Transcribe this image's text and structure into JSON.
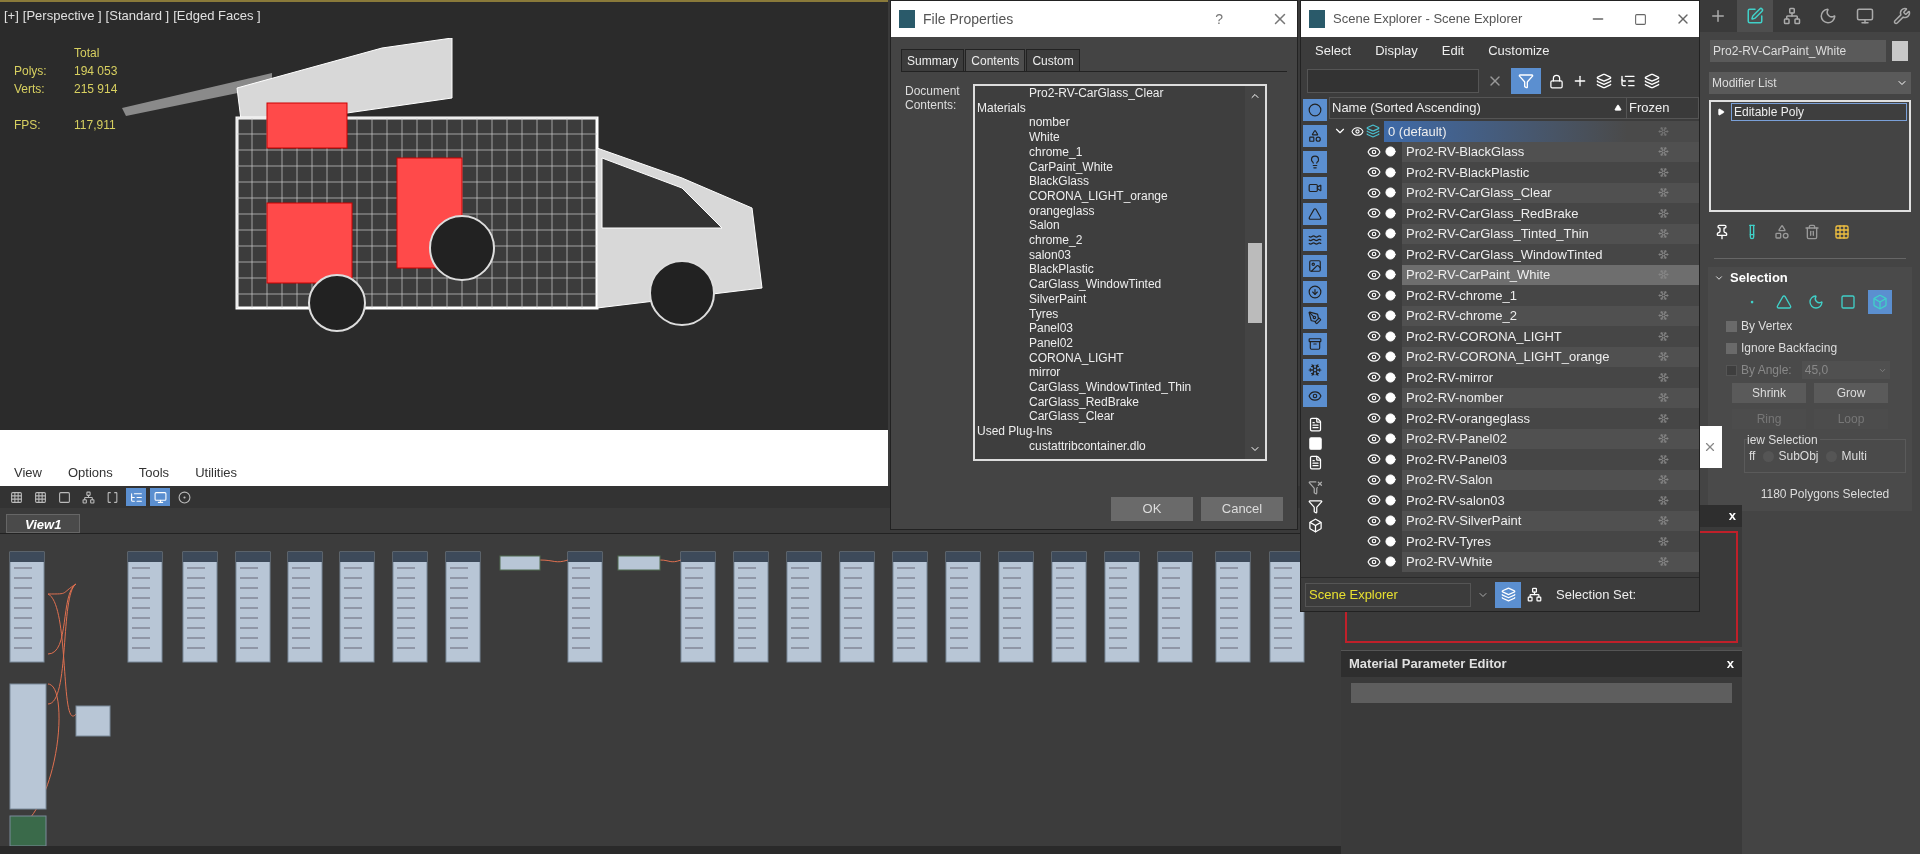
{
  "viewport": {
    "labels": [
      "[+]",
      "[Perspective ]",
      "[Standard ]",
      "[Edged Faces ]"
    ],
    "stats": {
      "header": "Total",
      "rows": [
        {
          "label": "Polys:",
          "value": "194 053"
        },
        {
          "label": "Verts:",
          "value": "215 914"
        }
      ],
      "fps": {
        "label": "FPS:",
        "value": "117,911"
      }
    }
  },
  "material_editor": {
    "menu": [
      "View",
      "Options",
      "Tools",
      "Utilities"
    ],
    "toolbar": [
      {
        "on": false
      },
      {
        "on": false
      },
      {
        "on": false
      },
      {
        "on": false
      },
      {
        "on": false
      },
      {
        "on": true
      },
      {
        "on": true
      },
      {
        "on": false
      }
    ],
    "tabs": [
      {
        "label": "View1",
        "selected": true
      }
    ],
    "navigator": {
      "close": "x"
    },
    "parameter_editor": {
      "title": "Material Parameter Editor",
      "close": "x"
    }
  },
  "file_properties": {
    "title": "File Properties",
    "help": "?",
    "tabs": [
      {
        "label": "Summary",
        "selected": false
      },
      {
        "label": "Contents",
        "selected": true
      },
      {
        "label": "Custom",
        "selected": false
      }
    ],
    "field_label": "Document Contents:",
    "contents": [
      {
        "items": [
          "Pro2-RV-CarGlass_Clear"
        ]
      },
      {
        "label": "Materials",
        "items": [
          "nomber",
          "White",
          "chrome_1",
          "CarPaint_White",
          "BlackGlass",
          "CORONA_LIGHT_orange",
          "orangeglass",
          "Salon",
          "chrome_2",
          "salon03",
          "BlackPlastic",
          "CarGlass_WindowTinted",
          "SilverPaint",
          "Tyres",
          "Panel03",
          "Panel02",
          "CORONA_LIGHT",
          "mirror",
          "CarGlass_WindowTinted_Thin",
          "CarGlass_RedBrake",
          "CarGlass_Clear"
        ]
      },
      {
        "label": "Used Plug-Ins",
        "items": [
          "custattribcontainer.dlo"
        ]
      }
    ],
    "buttons": [
      "OK",
      "Cancel"
    ]
  },
  "scene_explorer": {
    "title": "Scene Explorer - Scene Explorer",
    "menu": [
      "Select",
      "Display",
      "Edit",
      "Customize"
    ],
    "filter_active": true,
    "filters": [
      {
        "on": true
      },
      {
        "on": true
      },
      {
        "on": true
      },
      {
        "on": true
      },
      {
        "on": true
      },
      {
        "on": true
      },
      {
        "on": true
      },
      {
        "on": true
      },
      {
        "on": true
      },
      {
        "on": true
      },
      {
        "on": true
      },
      {
        "on": true
      }
    ],
    "columns": [
      "Name (Sorted Ascending)",
      "Frozen"
    ],
    "layer": {
      "name": "0 (default)",
      "expanded": true,
      "selected": true,
      "children": [
        {
          "name": "Pro2-RV-BlackGlass",
          "selected": false
        },
        {
          "name": "Pro2-RV-BlackPlastic",
          "selected": false
        },
        {
          "name": "Pro2-RV-CarGlass_Clear",
          "selected": false
        },
        {
          "name": "Pro2-RV-CarGlass_RedBrake",
          "selected": false
        },
        {
          "name": "Pro2-RV-CarGlass_Tinted_Thin",
          "selected": false
        },
        {
          "name": "Pro2-RV-CarGlass_WindowTinted",
          "selected": false
        },
        {
          "name": "Pro2-RV-CarPaint_White",
          "selected": true
        },
        {
          "name": "Pro2-RV-chrome_1",
          "selected": false
        },
        {
          "name": "Pro2-RV-chrome_2",
          "selected": false
        },
        {
          "name": "Pro2-RV-CORONA_LIGHT",
          "selected": false
        },
        {
          "name": "Pro2-RV-CORONA_LIGHT_orange",
          "selected": false
        },
        {
          "name": "Pro2-RV-mirror",
          "selected": false
        },
        {
          "name": "Pro2-RV-nomber",
          "selected": false
        },
        {
          "name": "Pro2-RV-orangeglass",
          "selected": false
        },
        {
          "name": "Pro2-RV-Panel02",
          "selected": false
        },
        {
          "name": "Pro2-RV-Panel03",
          "selected": false
        },
        {
          "name": "Pro2-RV-Salon",
          "selected": false
        },
        {
          "name": "Pro2-RV-salon03",
          "selected": false
        },
        {
          "name": "Pro2-RV-SilverPaint",
          "selected": false
        },
        {
          "name": "Pro2-RV-Tyres",
          "selected": false
        },
        {
          "name": "Pro2-RV-White",
          "selected": false
        }
      ]
    },
    "footer": {
      "explorer": "Scene Explorer",
      "layers_on": true,
      "selection_set": "Selection Set:"
    }
  },
  "command_panel": {
    "tabs": [
      {
        "selected": false
      },
      {
        "selected": true
      },
      {
        "selected": false
      },
      {
        "selected": false
      },
      {
        "selected": false
      },
      {
        "selected": false
      }
    ],
    "object_name": "Pro2-RV-CarPaint_White",
    "modifier_list": "Modifier List",
    "stack": [
      {
        "name": "Editable Poly",
        "selected": true
      }
    ],
    "selection": {
      "title": "Selection",
      "levels": [
        {
          "selected": false
        },
        {
          "selected": false
        },
        {
          "selected": false
        },
        {
          "selected": false
        },
        {
          "selected": true
        }
      ],
      "checks": [
        {
          "label": "By Vertex",
          "checked": false,
          "disabled": false
        },
        {
          "label": "Ignore Backfacing",
          "checked": false,
          "disabled": false
        },
        {
          "label": "By Angle:",
          "checked": false,
          "disabled": true
        }
      ],
      "angle": "45,0",
      "buttons": [
        {
          "label": "Shrink",
          "disabled": false
        },
        {
          "label": "Grow",
          "disabled": false
        },
        {
          "label": "Ring",
          "disabled": true
        },
        {
          "label": "Loop",
          "disabled": true
        }
      ],
      "preview": {
        "title": "iew Selection",
        "cut_option": "ff",
        "options": [
          {
            "label": "SubObj",
            "selected": false
          },
          {
            "label": "Multi",
            "selected": false
          }
        ]
      },
      "status": "1180 Polygons Selected"
    }
  }
}
